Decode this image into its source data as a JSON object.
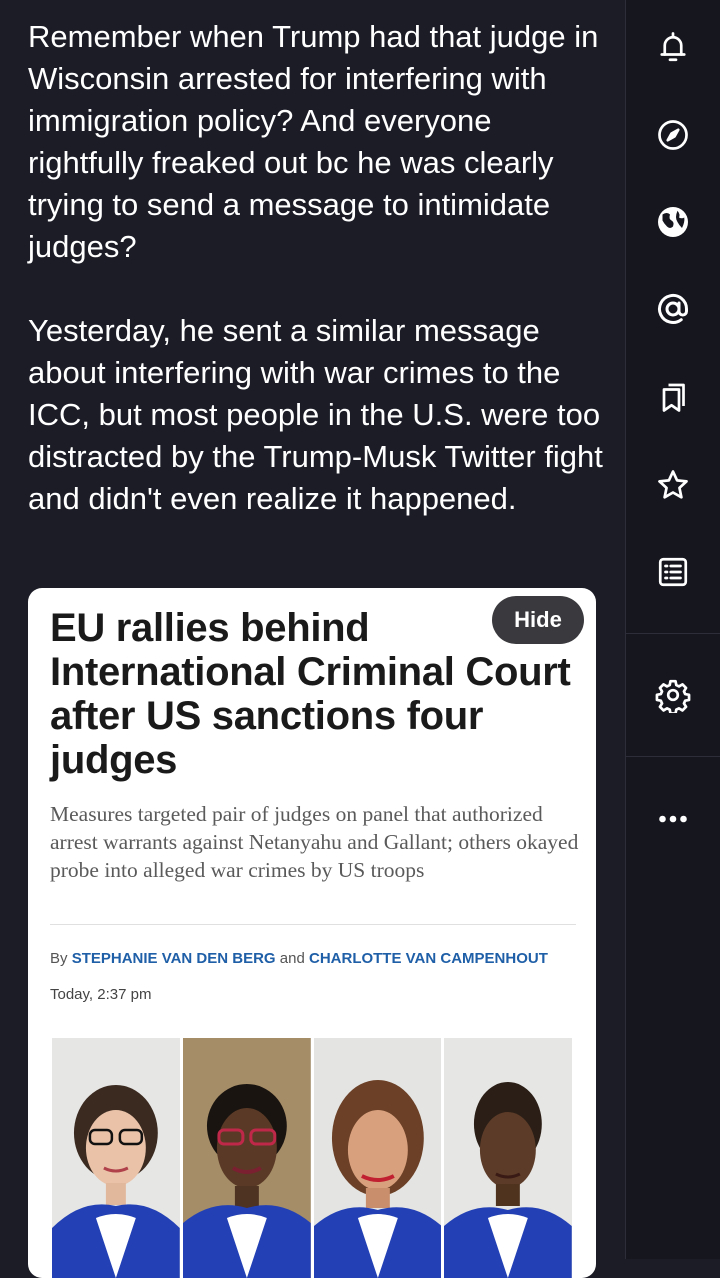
{
  "post": {
    "paragraphs": [
      "Remember when Trump had that judge in Wisconsin arrested for interfering with immigration policy? And everyone rightfully freaked out bc he was clearly trying to send a message to intimidate judges?",
      "Yesterday, he sent a similar message about interfering with war crimes to the ICC, but most people in the U.S. were too distracted by the Trump-Musk Twitter fight and didn't even realize it happened."
    ]
  },
  "article": {
    "hide_label": "Hide",
    "headline": "EU rallies behind International Criminal Court after US sanctions four judges",
    "subhead": "Measures targeted pair of judges on panel that authorized arrest warrants against Netanyahu and Gallant; others okayed probe into alleged war crimes by US troops",
    "byline_prefix": "By",
    "author1": "STEPHANIE VAN DEN BERG",
    "byline_and": "and",
    "author2": "CHARLOTTE VAN CAMPENHOUT",
    "timestamp": "Today, 2:37 pm"
  },
  "rail": {
    "icons": [
      "bell-icon",
      "compass-icon",
      "globe-icon",
      "at-icon",
      "bookmarks-icon",
      "star-icon",
      "list-icon",
      "gear-icon",
      "more-icon"
    ]
  },
  "colors": {
    "background": "#1b1c26",
    "rail": "#15161e",
    "link": "#1f5fa8",
    "robe_blue": "#1f3fb0"
  }
}
